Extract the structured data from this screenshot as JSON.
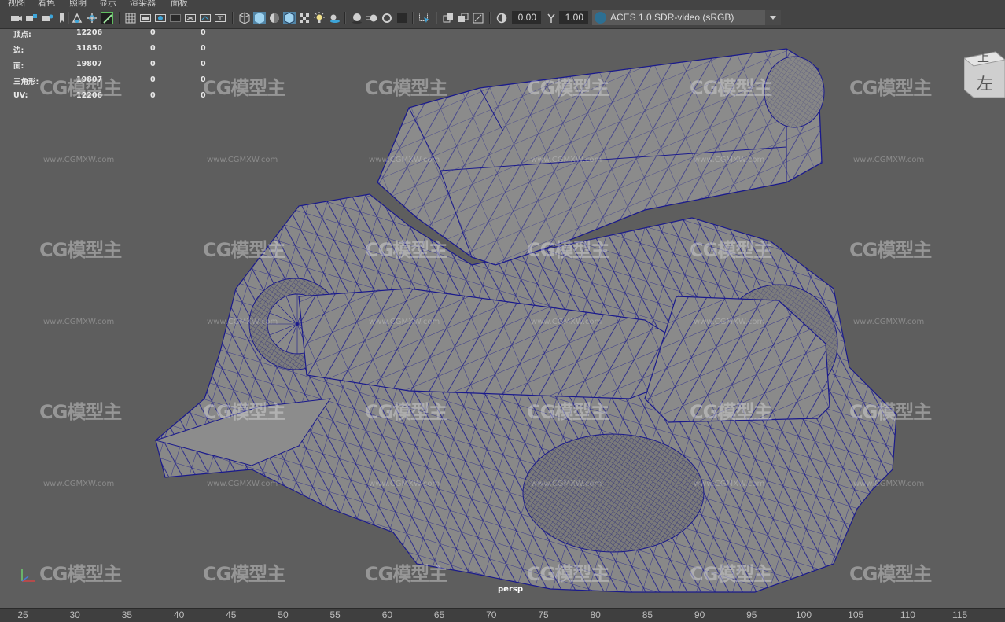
{
  "menu": {
    "items": [
      "视图",
      "着色",
      "照明",
      "显示",
      "渲染器",
      "面板"
    ]
  },
  "toolbar": {
    "icons": [
      "camera-icon",
      "camera-attr-icon",
      "bookmark-icon",
      "image-plane-icon",
      "grid-icon",
      "film-gate-icon",
      "resolution-gate-icon",
      "gate-mask-icon",
      "field-chart-icon",
      "safe-action-icon",
      "safe-title-icon",
      "wireframe-icon",
      "smooth-shade-icon",
      "use-default-material-icon",
      "wireframe-on-shaded-icon",
      "textured-icon",
      "lights-icon",
      "shadows-icon",
      "screen-ambient-occlusion-icon",
      "motion-blur-icon",
      "anti-aliasing-icon",
      "isolate-select-icon",
      "xray-icon",
      "xray-active-icon",
      "xray-joints-icon",
      "backface-culling-icon",
      "exposure-icon",
      "gamma-icon"
    ],
    "exposure_value": "0.00",
    "gamma_value": "1.00",
    "color_space": "ACES 1.0 SDR-video (sRGB)"
  },
  "hud": {
    "rows": [
      {
        "label": "顶点:",
        "a": "12206",
        "b": "0",
        "c": "0"
      },
      {
        "label": "边:",
        "a": "31850",
        "b": "0",
        "c": "0"
      },
      {
        "label": "面:",
        "a": "19807",
        "b": "0",
        "c": "0"
      },
      {
        "label": "三角形:",
        "a": "19807",
        "b": "0",
        "c": "0"
      },
      {
        "label": "UV:",
        "a": "12206",
        "b": "0",
        "c": "0"
      }
    ]
  },
  "viewcube": {
    "top_face": "上",
    "side_face": "左"
  },
  "watermark": {
    "logo": "CG模型主",
    "url": "www.CGMXW.com"
  },
  "camera_label": "persp",
  "timeline": {
    "ticks": [
      "25",
      "30",
      "35",
      "40",
      "45",
      "50",
      "55",
      "60",
      "65",
      "70",
      "75",
      "80",
      "85",
      "90",
      "95",
      "100",
      "105",
      "110",
      "115"
    ]
  },
  "colors": {
    "wire": "#1a1a8c",
    "shaded": "#8a8a8a",
    "viewport_bg": "#5e5e5e"
  }
}
